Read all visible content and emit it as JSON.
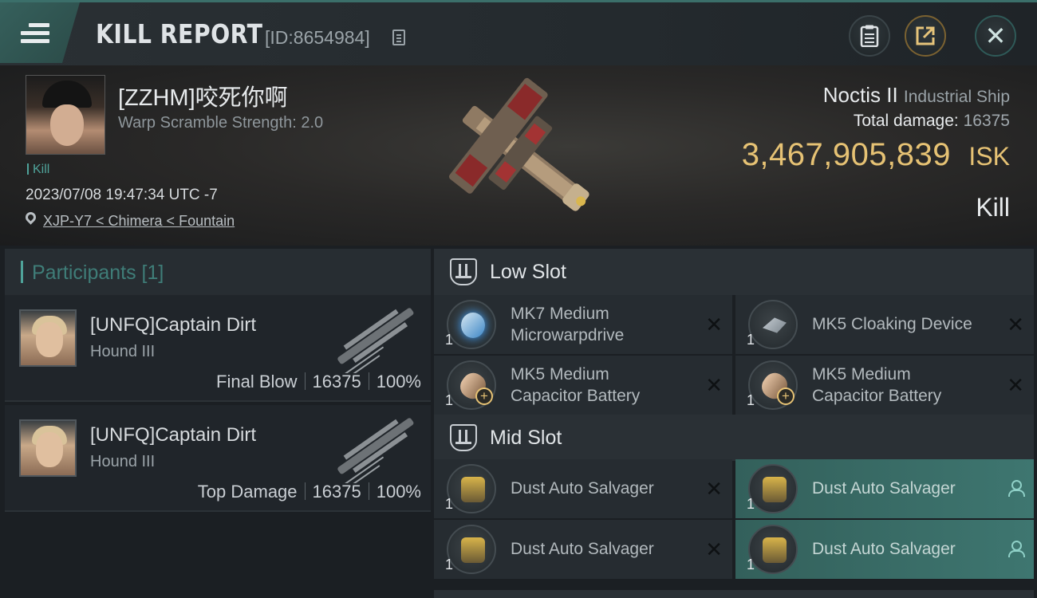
{
  "header": {
    "title": "KILL REPORT",
    "report_id": "[ID:8654984]",
    "icons": {
      "menu": "hamburger-menu-icon",
      "copy": "copy-icon",
      "clipboard": "clipboard-icon",
      "share": "share-icon",
      "close": "close-icon"
    }
  },
  "victim": {
    "name": "[ZZHM]咬死你啊",
    "warp_scramble": "Warp Scramble Strength: 2.0",
    "tag": "Kill",
    "datetime": "2023/07/08 19:47:34 UTC -7",
    "location": "XJP-Y7 < Chimera < Fountain",
    "ship_name": "Noctis II",
    "ship_class": "Industrial Ship",
    "total_damage_label": "Total damage:",
    "total_damage": "16375",
    "isk_value": "3,467,905,839",
    "isk_unit": "ISK",
    "result": "Kill"
  },
  "participants": {
    "title": "Participants [1]",
    "rows": [
      {
        "name": "[UNFQ]Captain Dirt",
        "ship": "Hound III",
        "role": "Final Blow",
        "damage": "16375",
        "percent": "100%"
      },
      {
        "name": "[UNFQ]Captain Dirt",
        "ship": "Hound III",
        "role": "Top Damage",
        "damage": "16375",
        "percent": "100%"
      }
    ]
  },
  "slots": {
    "low": {
      "title": "Low Slot",
      "modules": [
        {
          "line1": "MK7 Medium",
          "line2": "Microwarpdrive",
          "qty": "1"
        },
        {
          "line1": "MK5 Cloaking Device",
          "line2": "",
          "qty": "1"
        },
        {
          "line1": "MK5 Medium",
          "line2": "Capacitor Battery",
          "qty": "1"
        },
        {
          "line1": "MK5 Medium",
          "line2": "Capacitor Battery",
          "qty": "1"
        }
      ]
    },
    "mid": {
      "title": "Mid Slot",
      "modules": [
        {
          "line1": "Dust Auto Salvager",
          "qty": "1",
          "status": "destroyed"
        },
        {
          "line1": "Dust Auto Salvager",
          "qty": "1",
          "status": "dropped"
        },
        {
          "line1": "Dust Auto Salvager",
          "qty": "1",
          "status": "destroyed"
        },
        {
          "line1": "Dust Auto Salvager",
          "qty": "1",
          "status": "dropped"
        }
      ]
    }
  },
  "colors": {
    "accent": "#4fa39a",
    "isk": "#e6c274",
    "active_module": "#3e7670"
  }
}
